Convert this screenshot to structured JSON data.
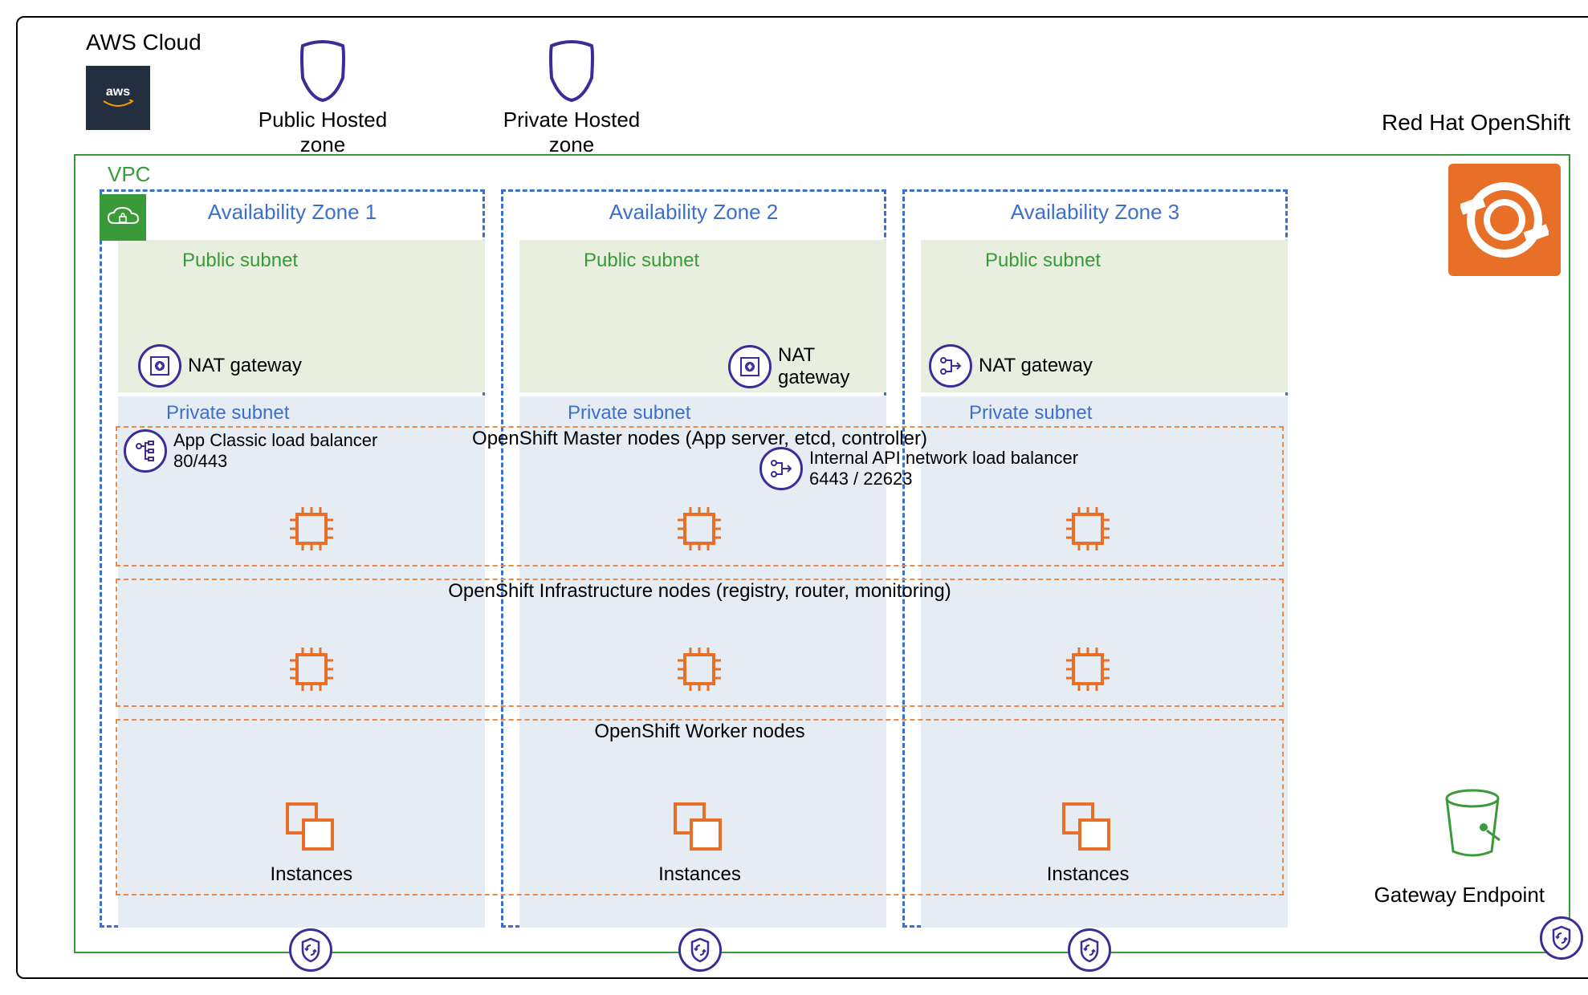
{
  "cloud_label": "AWS Cloud",
  "aws_logo_text": "aws",
  "zones_top": {
    "public_hosted": "Public Hosted zone",
    "private_hosted": "Private Hosted zone"
  },
  "redhat": "Red Hat OpenShift",
  "vpc": {
    "label": "VPC",
    "az1": "Availability Zone 1",
    "az2": "Availability Zone 2",
    "az3": "Availability Zone 3",
    "public_subnet": "Public subnet",
    "private_subnet": "Private subnet",
    "nat_gateway": "NAT gateway"
  },
  "applb": {
    "line1": "App Classic load balancer",
    "line2": "80/443"
  },
  "ilb": {
    "line1": "Internal API network load balancer",
    "line2": "6443 / 22623"
  },
  "tiers": {
    "master": "OpenShift Master nodes (App server, etcd, controller)",
    "infra": "OpenShift Infrastructure nodes (registry, router, monitoring)",
    "worker": "OpenShift Worker nodes"
  },
  "instances_label": "Instances",
  "gateway_endpoint": "Gateway Endpoint"
}
